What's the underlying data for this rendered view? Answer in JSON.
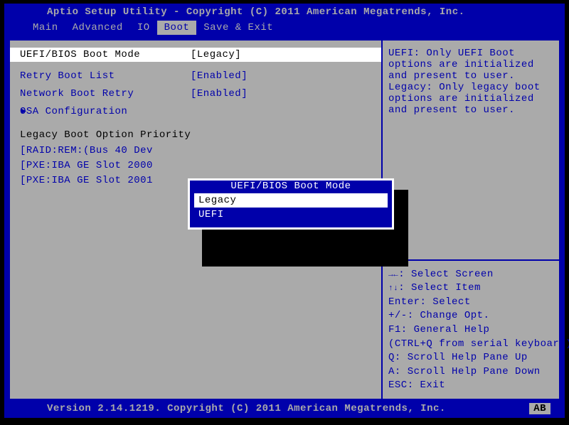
{
  "header": {
    "title": "Aptio Setup Utility - Copyright (C) 2011 American Megatrends, Inc."
  },
  "menubar": {
    "items": [
      {
        "label": "Main"
      },
      {
        "label": "Advanced"
      },
      {
        "label": "IO"
      },
      {
        "label": "Boot"
      },
      {
        "label": "Save & Exit"
      }
    ],
    "active_index": 3
  },
  "settings": {
    "boot_mode": {
      "label": "UEFI/BIOS Boot Mode",
      "value": "[Legacy]"
    },
    "retry_boot": {
      "label": "Retry Boot List",
      "value": "[Enabled]"
    },
    "network_retry": {
      "label": "Network Boot Retry",
      "value": "[Enabled]"
    },
    "osa_config": {
      "label": "OSA Configuration"
    }
  },
  "legacy_section": {
    "header": "Legacy Boot Option Priority",
    "items": [
      "[RAID:REM:(Bus 40 Dev",
      "[PXE:IBA GE Slot 2000",
      "[PXE:IBA GE Slot 2001"
    ]
  },
  "popup": {
    "title": "UEFI/BIOS Boot Mode",
    "options": [
      "Legacy",
      "UEFI"
    ],
    "selected_index": 0
  },
  "help": {
    "text": "UEFI: Only UEFI Boot options are initialized and present to user. Legacy: Only legacy boot options are initialized and present to user."
  },
  "keys": {
    "screen": "Select Screen",
    "item": "Select Item",
    "enter": "Enter: Select",
    "change": "+/-: Change Opt.",
    "help2": "F1: General Help",
    "ctrl": "(CTRL+Q from serial keyboard)",
    "q": "Q: Scroll Help Pane Up",
    "a": "A: Scroll Help Pane Down",
    "esc": "ESC: Exit"
  },
  "footer": {
    "version": "Version 2.14.1219. Copyright (C) 2011 American Megatrends, Inc.",
    "corner": "AB"
  }
}
